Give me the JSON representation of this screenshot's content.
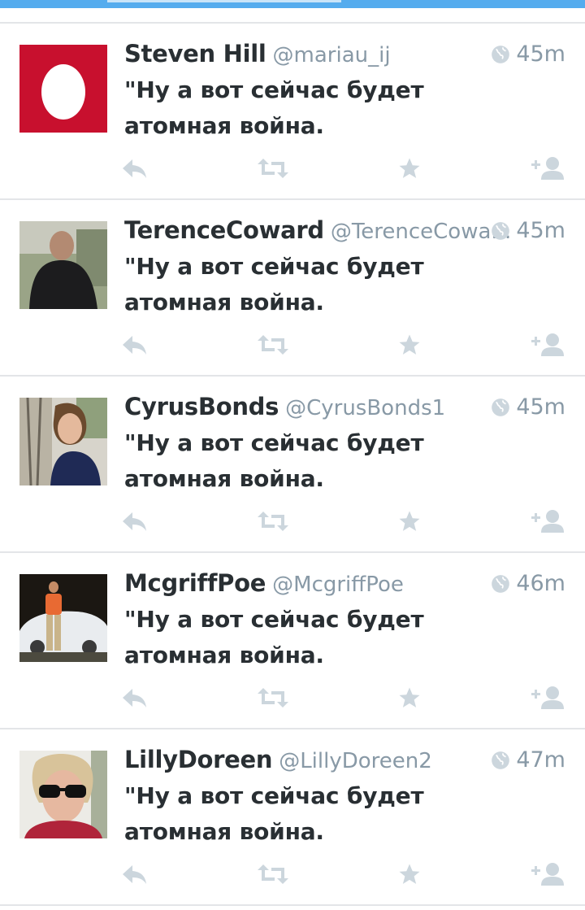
{
  "colors": {
    "accent": "#55acee",
    "text": "#292f33",
    "muted": "#8899a6",
    "action": "#ccd6dd",
    "divider": "#e3e5e8"
  },
  "tweets": [
    {
      "name": "Steven Hill",
      "handle": "@mariau_ij",
      "time": "45m",
      "text": "\"Ну а вот сейчас будет атомная война.",
      "avatar": "default-egg-avatar"
    },
    {
      "name": "TerenceCoward",
      "handle": "@TerenceCowa...",
      "time": "45m",
      "text": "\"Ну а вот сейчас будет атомная война.",
      "avatar": "photo-man-dark-jacket"
    },
    {
      "name": "CyrusBonds",
      "handle": "@CyrusBonds1",
      "time": "45m",
      "text": "\"Ну а вот сейчас будет атомная война.",
      "avatar": "photo-woman-tree"
    },
    {
      "name": "McgriffPoe",
      "handle": "@McgriffPoe",
      "time": "46m",
      "text": "\"Ну а вот сейчас будет атомная война.",
      "avatar": "photo-man-white-car"
    },
    {
      "name": "LillyDoreen",
      "handle": "@LillyDoreen2",
      "time": "47m",
      "text": "\"Ну а вот сейчас будет атомная война.",
      "avatar": "photo-person-sunglasses"
    }
  ],
  "actions": [
    "reply-icon",
    "retweet-icon",
    "favorite-icon",
    "follow-icon"
  ]
}
